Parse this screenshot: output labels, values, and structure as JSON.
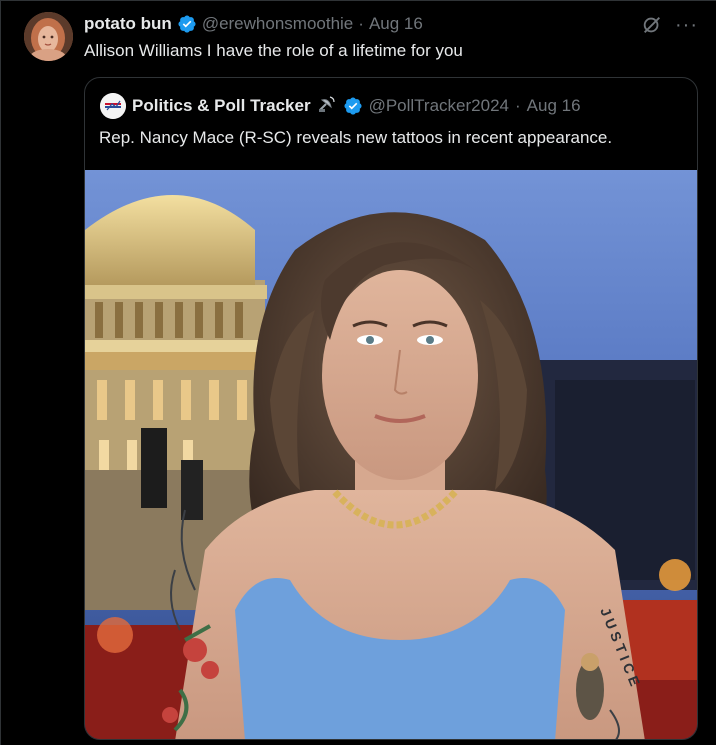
{
  "tweet": {
    "author_name": "potato bun",
    "author_handle": "@erewhonsmoothie",
    "separator": "·",
    "date": "Aug 16",
    "text": "Allison Williams I have the role of a lifetime for you",
    "more_label": "···"
  },
  "quote": {
    "author_name": "Politics & Poll Tracker",
    "author_handle": "@PollTracker2024",
    "separator": "·",
    "date": "Aug 16",
    "text": "Rep. Nancy Mace (R-SC) reveals new tattoos in recent appearance.",
    "tattoo_text": "JUSTICE"
  },
  "colors": {
    "background": "#000000",
    "text": "#e7e9ea",
    "muted": "#71767b",
    "border": "#2f3336",
    "verified": "#1d9bf0",
    "top_blue": "#6f8fd0",
    "dress": "#6ea0dc"
  },
  "icons": {
    "verified": "verified-badge-icon",
    "grok": "grok-icon",
    "more": "more-icon",
    "satellite": "satellite-dish-icon"
  }
}
